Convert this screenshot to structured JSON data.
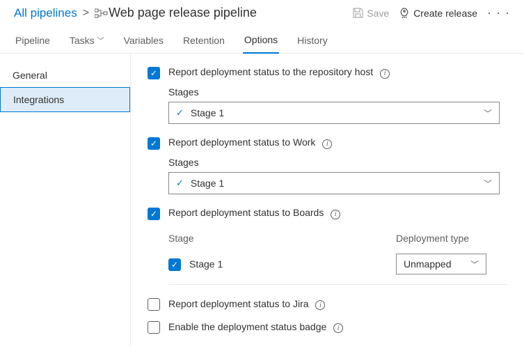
{
  "breadcrumb": {
    "root": "All pipelines",
    "title": "Web page release pipeline"
  },
  "actions": {
    "save": "Save",
    "create_release": "Create release"
  },
  "tabs": {
    "pipeline": "Pipeline",
    "tasks": "Tasks",
    "variables": "Variables",
    "retention": "Retention",
    "options": "Options",
    "history": "History"
  },
  "sidebar": {
    "general": "General",
    "integrations": "Integrations"
  },
  "opts": {
    "repo": {
      "label": "Report deployment status to the repository host",
      "stages_label": "Stages",
      "stage_value": "Stage 1"
    },
    "work": {
      "label": "Report deployment status to Work",
      "stages_label": "Stages",
      "stage_value": "Stage 1"
    },
    "boards": {
      "label": "Report deployment status to Boards",
      "col_stage": "Stage",
      "col_deploy": "Deployment type",
      "row_stage": "Stage 1",
      "row_deploy": "Unmapped"
    },
    "jira": {
      "label": "Report deployment status to Jira"
    },
    "badge": {
      "label": "Enable the deployment status badge"
    }
  }
}
